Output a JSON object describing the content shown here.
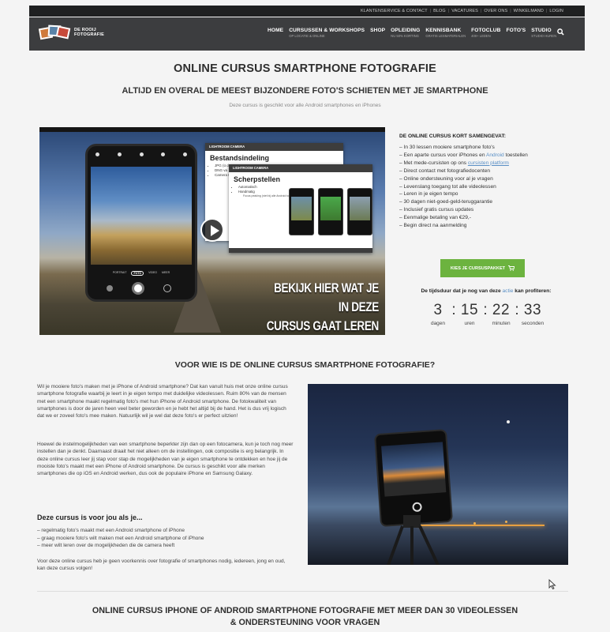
{
  "topbar": {
    "links": [
      "KLANTENSERVICE & CONTACT",
      "BLOG",
      "VACATURES",
      "OVER ONS",
      "WINKELMAND",
      "LOGIN"
    ]
  },
  "logo": {
    "line1": "DE ROOIJ",
    "line2": "FOTOGRAFIE"
  },
  "nav": [
    {
      "label": "HOME",
      "sub": ""
    },
    {
      "label": "CURSUSSEN & WORKSHOPS",
      "sub": "OP LOCATIE & ONLINE"
    },
    {
      "label": "SHOP",
      "sub": ""
    },
    {
      "label": "OPLEIDING",
      "sub": "NU 50% KORTING"
    },
    {
      "label": "KENNISBANK",
      "sub": "GRATIS LESMATERIALEN"
    },
    {
      "label": "FOTOCLUB",
      "sub": "400+ LEDEN"
    },
    {
      "label": "FOTO'S",
      "sub": ""
    },
    {
      "label": "STUDIO",
      "sub": "STUDIO HUREN"
    }
  ],
  "page": {
    "title": "ONLINE CURSUS SMARTPHONE FOTOGRAFIE",
    "subtitle": "ALTIJD EN OVERAL DE MEEST BIJZONDERE FOTO'S SCHIETEN MET JE SMARTPHONE",
    "note": "Deze cursus is geschikt voor alle Android smartphones en iPhones"
  },
  "video": {
    "cta_line1": "BEKIJK HIER WAT JE IN DEZE",
    "cta_line2": "CURSUS GAAT LEREN",
    "slide1_bar": "LIGHTROOM CAMERA",
    "slide1_title": "Bestandsindeling",
    "slide1_items": [
      "JPG (ü dg",
      "DNG va",
      "Camera DNG"
    ],
    "slide2_bar": "LIGHTROOM CAMERA",
    "slide2_title": "Scherpstellen",
    "slide2_items": [
      "Automatisch",
      "Handmatig"
    ],
    "slide2_sub": "Focus peaking (niet bij alle Android toestellen)",
    "phone_modes": [
      "PORTRAIT",
      "FOTO",
      "VIDEO",
      "MEER"
    ]
  },
  "summary": {
    "title": "DE ONLINE CURSUS KORT SAMENGEVAT:",
    "items": [
      "– In 30 lessen mooiere smartphone foto's",
      "– Een aparte cursus voor iPhones en Android toestellen",
      "– Met mede-cursisten op ons",
      "– Direct contact met fotografiedocenten",
      "– Online ondersteuning voor al je vragen",
      "– Levenslang toegang tot alle videolessen",
      "– Leren in je eigen tempo",
      "– 30 dagen niet-goed-geld-teruggarantie",
      "– Inclusief gratis cursus updates",
      "– Eenmalige betaling van €29,-",
      "– Begin direct na aanmelding"
    ],
    "platform_link": "cursisten platform"
  },
  "buy_button": "KIES JE CURSUSPAKKET",
  "timer": {
    "label_pre": "De tijdsduur dat je nog van deze",
    "label_link": "actie",
    "label_post": "kan profiteren:",
    "days": "3",
    "hours": "15",
    "minutes": "22",
    "seconds": "33",
    "days_label": "dagen",
    "hours_label": "uren",
    "minutes_label": "minuten",
    "seconds_label": "seconden"
  },
  "section2": {
    "title": "VOOR WIE IS DE ONLINE CURSUS SMARTPHONE FOTOGRAFIE?",
    "p1": "Wil je mooiere foto's maken met je iPhone of Android smartphone? Dat kan vanuit huis met onze online cursus smartphone fotografie waarbij je leert in je eigen tempo met duidelijke videolessen. Ruim 80% van de mensen met een smartphone maakt regelmatig foto's met hun iPhone of Android smartphone. De fotokwaliteit van smartphones is door de jaren heen veel beter geworden en je hebt het altijd bij de hand. Het is dus vrij logisch dat we er zoveel foto's mee maken. Natuurlijk wil je wel dat deze foto's er perfect uitzien!",
    "p2": "Hoewel de instelmogelijkheden van een smartphone beperkter zijn dan op een fotocamera, kun je toch nog meer instellen dan je denkt. Daarnaast draait het niet alleen om de instellingen, ook compositie is erg belangrijk. In deze online cursus leer jij stap voor stap de mogelijkheden van je eigen smartphone te ontdekken en hoe jij de mooiste foto's maakt met een iPhone of Android smartphone. De cursus is geschikt voor alle merken smartphones die op iOS en Android werken, dus ook de populaire iPhone en Samsung Galaxy.",
    "h4": "Deze cursus is voor jou als je...",
    "list": [
      "– regelmatig foto's maakt met een Android smartphone of iPhone",
      "– graag mooiere foto's wilt maken met een Android smartphone of iPhone",
      "– meer wilt leren over de mogelijkheden die de camera heeft"
    ],
    "p3": "Voor deze online cursus  heb je geen voorkennis over fotografie of smartphones nodig, iedereen, jong en oud, kan deze cursus volgen!"
  },
  "section3": {
    "title_line1": "ONLINE CURSUS IPHONE OF ANDROID SMARTPHONE FOTOGRAFIE MET MEER DAN 30 VIDEOLESSEN",
    "title_line2": "& ONDERSTEUNING VOOR VRAGEN"
  },
  "colors": {
    "nav_bg": "#3c3d3f",
    "topbar_bg": "#1f2021",
    "accent_green": "#6cb33f",
    "link_blue": "#5a8fc5"
  }
}
